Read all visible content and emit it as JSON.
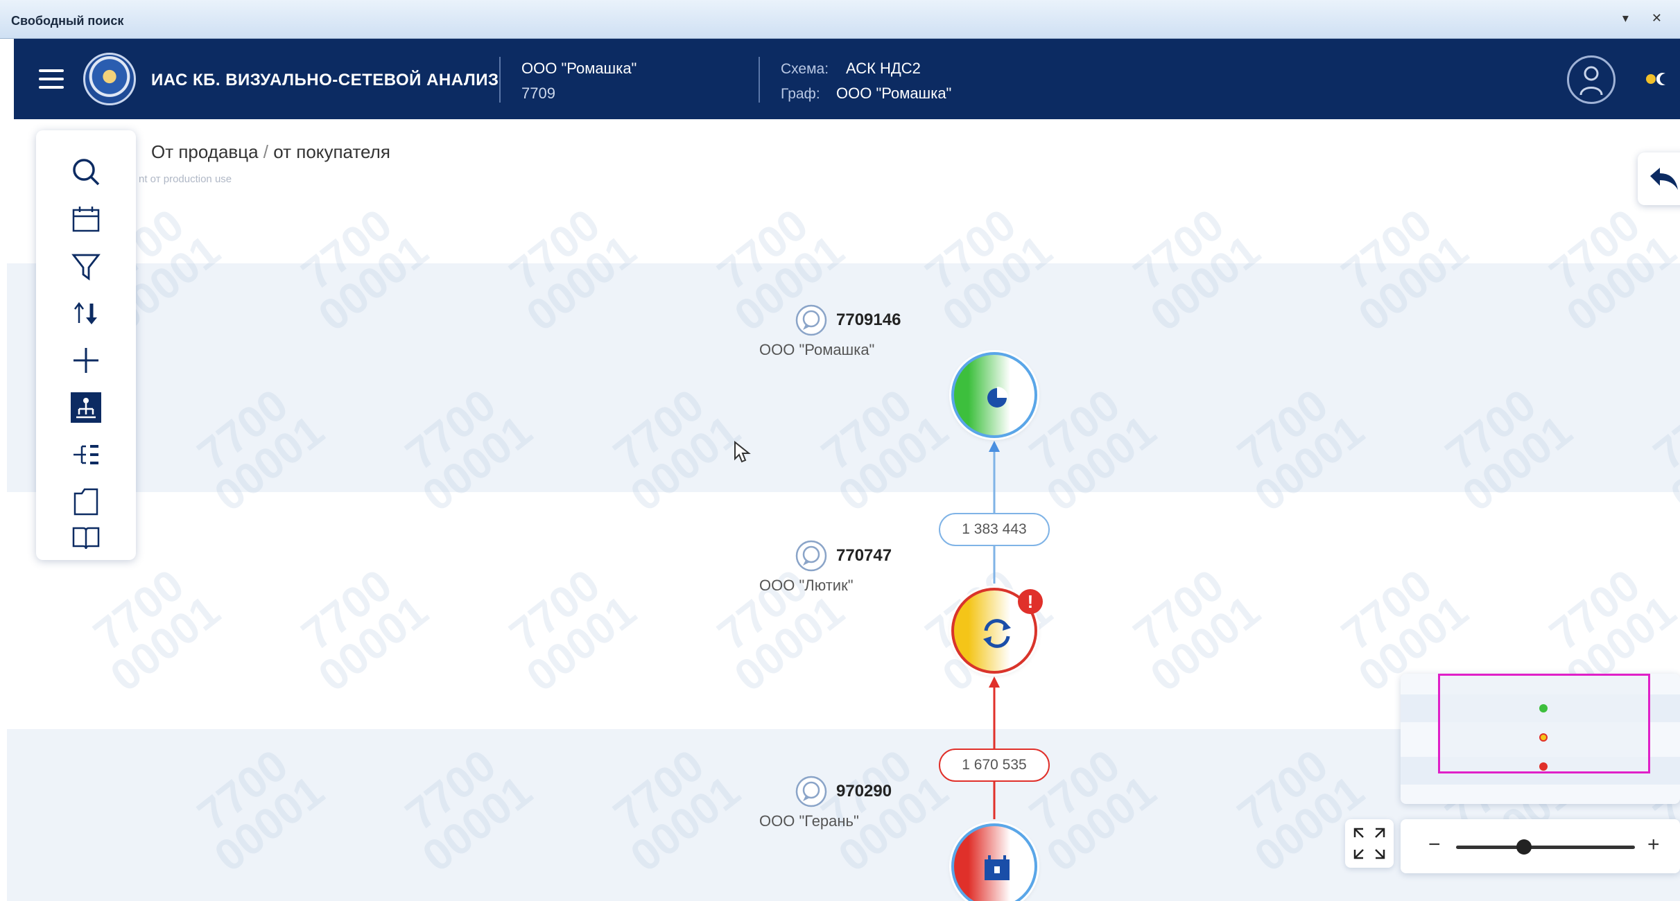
{
  "window": {
    "title": "Свободный поиск",
    "controls": "▾ ✕"
  },
  "header": {
    "app_title": "ИАС КБ. ВИЗУАЛЬНО-СЕТЕВОЙ АНАЛИЗ",
    "org": {
      "name": "ООО \"Ромашка\"",
      "inn": "7709"
    },
    "scheme_label": "Схема:",
    "scheme_value": "АСК НДС2",
    "graph_label": "Граф:",
    "graph_value": "ООО \"Ромашка\""
  },
  "breadcrumb": {
    "first": "От продавца",
    "separator": " / ",
    "second": "от покупателя"
  },
  "faint_text": "nt от production use",
  "toolbar": {
    "items": [
      {
        "icon": "search-icon"
      },
      {
        "icon": "calendar-icon"
      },
      {
        "icon": "filter-icon"
      },
      {
        "icon": "sort-icon"
      },
      {
        "icon": "plus-icon"
      },
      {
        "icon": "hierarchy-icon",
        "active": true
      },
      {
        "icon": "tree-expand-icon"
      },
      {
        "icon": "folder-icon"
      },
      {
        "icon": "book-icon"
      }
    ]
  },
  "graph": {
    "nodes": [
      {
        "id": "7709146",
        "org": "ООО \"Ромашка\"",
        "icon": "pie-chart-icon",
        "color_left": "#3dbf3d",
        "color_right": "#ffffff",
        "border": "#5aa6e8"
      },
      {
        "id": "770747",
        "org": "ООО \"Лютик\"",
        "icon": "exchange-icon",
        "color_left": "#f4c518",
        "color_right": "#ffffff",
        "border": "#d9342b",
        "alert": "!"
      },
      {
        "id": "970290",
        "org": "ООО \"Герань\"",
        "icon": "calendar-badge-icon",
        "color_left": "#e0302a",
        "color_right": "#ffffff",
        "border": "#5aa6e8"
      }
    ],
    "edges": [
      {
        "label": "1 383 443",
        "color": "#7fb3e6"
      },
      {
        "label": "1 670 535",
        "color": "#e0302a"
      }
    ]
  },
  "watermark": "7700\n00001",
  "zoom": {
    "minus": "−",
    "plus": "+",
    "level": 0.38
  }
}
